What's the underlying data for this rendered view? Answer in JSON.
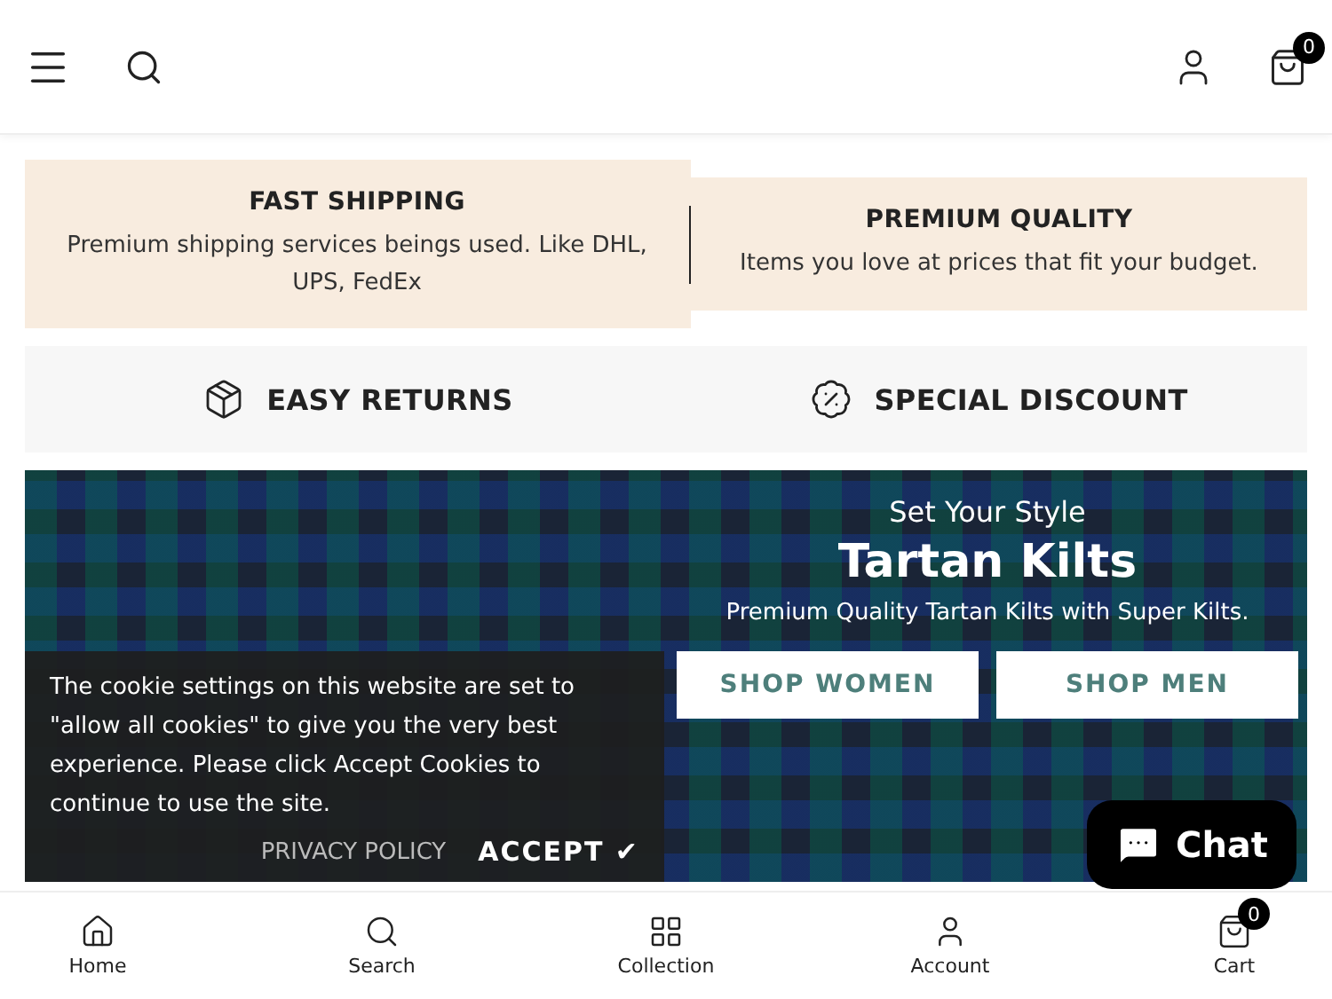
{
  "header": {
    "cart_count": "0"
  },
  "features": [
    {
      "kind": "text",
      "title": "FAST SHIPPING",
      "text": "Premium shipping services beings used. Like DHL, UPS, FedEx"
    },
    {
      "kind": "text",
      "title": "PREMIUM QUALITY",
      "text": "Items you love at prices that fit your budget."
    },
    {
      "kind": "icon",
      "title": "EASY RETURNS"
    },
    {
      "kind": "icon",
      "title": "SPECIAL DISCOUNT"
    }
  ],
  "hero": {
    "eyebrow": "Set Your Style",
    "title": "Tartan Kilts",
    "subtitle": "Premium Quality Tartan Kilts with Super Kilts.",
    "buttons": [
      "SHOP WOMEN",
      "SHOP MEN"
    ]
  },
  "cookie_banner": {
    "text": "The cookie settings on this website are set to \"allow all cookies\" to give you the very best experience. Please click Accept Cookies to continue to use the site.",
    "privacy_link": "PRIVACY POLICY",
    "accept": "ACCEPT ✔"
  },
  "chat": {
    "label": "Chat"
  },
  "bottom_nav": [
    {
      "label": "Home"
    },
    {
      "label": "Search"
    },
    {
      "label": "Collection"
    },
    {
      "label": "Account"
    },
    {
      "label": "Cart",
      "badge": "0"
    }
  ]
}
